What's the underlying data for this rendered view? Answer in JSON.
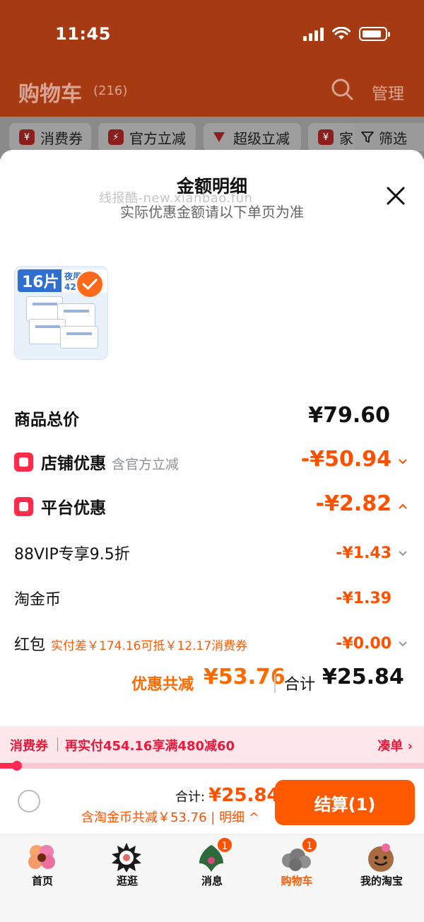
{
  "status_bar": {
    "time": "11:45"
  },
  "header": {
    "title": "购物车",
    "count": "(216)",
    "manage_label": "管理"
  },
  "filters": {
    "chips": [
      {
        "label": "消费券",
        "icon": "¥"
      },
      {
        "label": "官方立减",
        "icon": "⚡"
      },
      {
        "label": "超级立减",
        "icon": "arrow-down"
      },
      {
        "label": "家",
        "icon": "¥"
      }
    ],
    "filter_label": "筛选"
  },
  "sheet": {
    "title": "金额明细",
    "subtitle": "实际优惠金额请以下单页为准",
    "watermark": "线报酷-new.xianbao.fun",
    "product": {
      "badge": "16片",
      "tag": "夜用 包 42"
    }
  },
  "breakdown": {
    "goods_total": {
      "label": "商品总价",
      "value": "¥79.60"
    },
    "shop_discount": {
      "label": "店铺优惠",
      "note": "含官方立减",
      "value": "-¥50.94"
    },
    "platform_discount": {
      "label": "平台优惠",
      "value": "-¥2.82"
    },
    "vip": {
      "label": "88VIP专享9.5折",
      "value": "-¥1.43"
    },
    "coins": {
      "label": "淘金币",
      "value": "-¥1.39"
    },
    "red_packet": {
      "label": "红包",
      "note": "实付差￥174.16可抵￥12.17消费券",
      "value": "-¥0.00"
    },
    "saving_label": "优惠共减",
    "saving_value": "¥53.76",
    "total_label": "合计",
    "total_value": "¥25.84"
  },
  "voucher": {
    "tag": "消费券",
    "text": "再实付454.16享满480减60",
    "link": "凑单 ›",
    "progress": 0.04
  },
  "checkout_bar": {
    "total_label": "合计:",
    "total_value": "¥25.84",
    "saving_text": "含淘金币共减￥53.76 | 明细 ^",
    "button_label": "结算(1)"
  },
  "tabs": [
    {
      "label": "首页",
      "icon": "home-flower-icon"
    },
    {
      "label": "逛逛",
      "icon": "stroll-icon"
    },
    {
      "label": "消息",
      "icon": "message-icon",
      "badge": "1"
    },
    {
      "label": "购物车",
      "icon": "cart-icon",
      "badge": "1",
      "active": true
    },
    {
      "label": "我的淘宝",
      "icon": "profile-icon"
    }
  ],
  "colors": {
    "accent": "#ff5000",
    "header_bg": "#a63a12",
    "voucher_red": "#e8193c"
  }
}
